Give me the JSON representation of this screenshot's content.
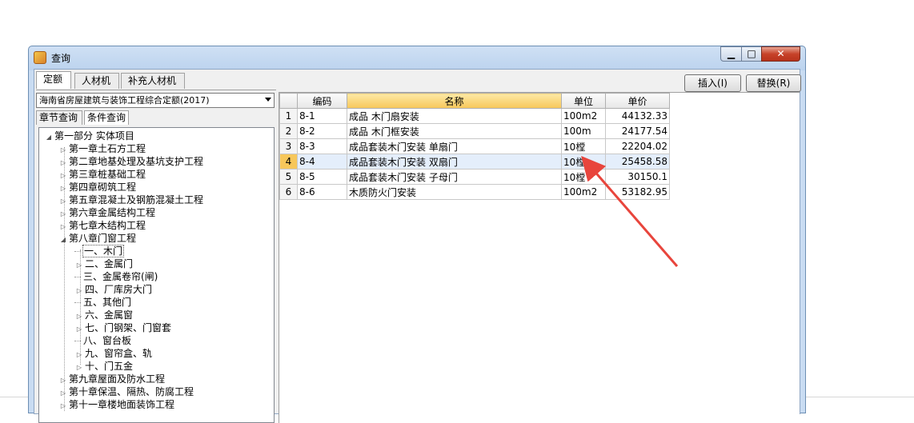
{
  "window": {
    "title": "查询",
    "minimize_glyph": "▁",
    "maximize_glyph": "□",
    "close_glyph": "✕",
    "icon": "app-icon"
  },
  "tabs": [
    {
      "label": "定额",
      "active": true
    },
    {
      "label": "人材机",
      "active": false
    },
    {
      "label": "补充人材机",
      "active": false
    }
  ],
  "buttons": {
    "insert": "插入(I)",
    "replace": "替换(R)"
  },
  "quota_selector": {
    "value": "海南省房屋建筑与装饰工程综合定额(2017)"
  },
  "subtabs": [
    {
      "label": "章节查询",
      "active": false
    },
    {
      "label": "条件查询",
      "active": true
    }
  ],
  "tree": [
    {
      "label": "第一部分 实体项目",
      "level": 0,
      "expander": "◢"
    },
    {
      "label": "第一章土石方工程",
      "level": 1,
      "expander": "▷"
    },
    {
      "label": "第二章地基处理及基坑支护工程",
      "level": 1,
      "expander": "▷"
    },
    {
      "label": "第三章桩基础工程",
      "level": 1,
      "expander": "▷"
    },
    {
      "label": "第四章砌筑工程",
      "level": 1,
      "expander": "▷"
    },
    {
      "label": "第五章混凝土及钢筋混凝土工程",
      "level": 1,
      "expander": "▷"
    },
    {
      "label": "第六章金属结构工程",
      "level": 1,
      "expander": "▷"
    },
    {
      "label": "第七章木结构工程",
      "level": 1,
      "expander": "▷"
    },
    {
      "label": "第八章门窗工程",
      "level": 1,
      "expander": "◢"
    },
    {
      "label": "一、木门",
      "level": 2,
      "expander": "",
      "selected": true
    },
    {
      "label": "二、金属门",
      "level": 2,
      "expander": "▷"
    },
    {
      "label": "三、金属卷帘(闸)",
      "level": 2,
      "expander": ""
    },
    {
      "label": "四、厂库房大门",
      "level": 2,
      "expander": "▷"
    },
    {
      "label": "五、其他门",
      "level": 2,
      "expander": ""
    },
    {
      "label": "六、金属窗",
      "level": 2,
      "expander": "▷"
    },
    {
      "label": "七、门钢架、门窗套",
      "level": 2,
      "expander": "▷"
    },
    {
      "label": "八、窗台板",
      "level": 2,
      "expander": ""
    },
    {
      "label": "九、窗帘盒、轨",
      "level": 2,
      "expander": "▷"
    },
    {
      "label": "十、门五金",
      "level": 2,
      "expander": "▷"
    },
    {
      "label": "第九章屋面及防水工程",
      "level": 1,
      "expander": "▷"
    },
    {
      "label": "第十章保温、隔热、防腐工程",
      "level": 1,
      "expander": "▷"
    },
    {
      "label": "第十一章楼地面装饰工程",
      "level": 1,
      "expander": "▷"
    }
  ],
  "grid": {
    "columns": [
      "编码",
      "名称",
      "单位",
      "单价"
    ],
    "rows": [
      {
        "no": "1",
        "code": "8-1",
        "name": "成品 木门扇安装",
        "unit": "100m2",
        "price": "44132.33"
      },
      {
        "no": "2",
        "code": "8-2",
        "name": "成品 木门框安装",
        "unit": "100m",
        "price": "24177.54"
      },
      {
        "no": "3",
        "code": "8-3",
        "name": "成品套装木门安装 单扇门",
        "unit": "10樘",
        "price": "22204.02"
      },
      {
        "no": "4",
        "code": "8-4",
        "name": "成品套装木门安装 双扇门",
        "unit": "10樘",
        "price": "25458.58",
        "current": true
      },
      {
        "no": "5",
        "code": "8-5",
        "name": "成品套装木门安装 子母门",
        "unit": "10樘",
        "price": "30150.1"
      },
      {
        "no": "6",
        "code": "8-6",
        "name": "木质防火门安装",
        "unit": "100m2",
        "price": "53182.95"
      }
    ]
  },
  "annotation": {
    "color": "#e8453c"
  }
}
